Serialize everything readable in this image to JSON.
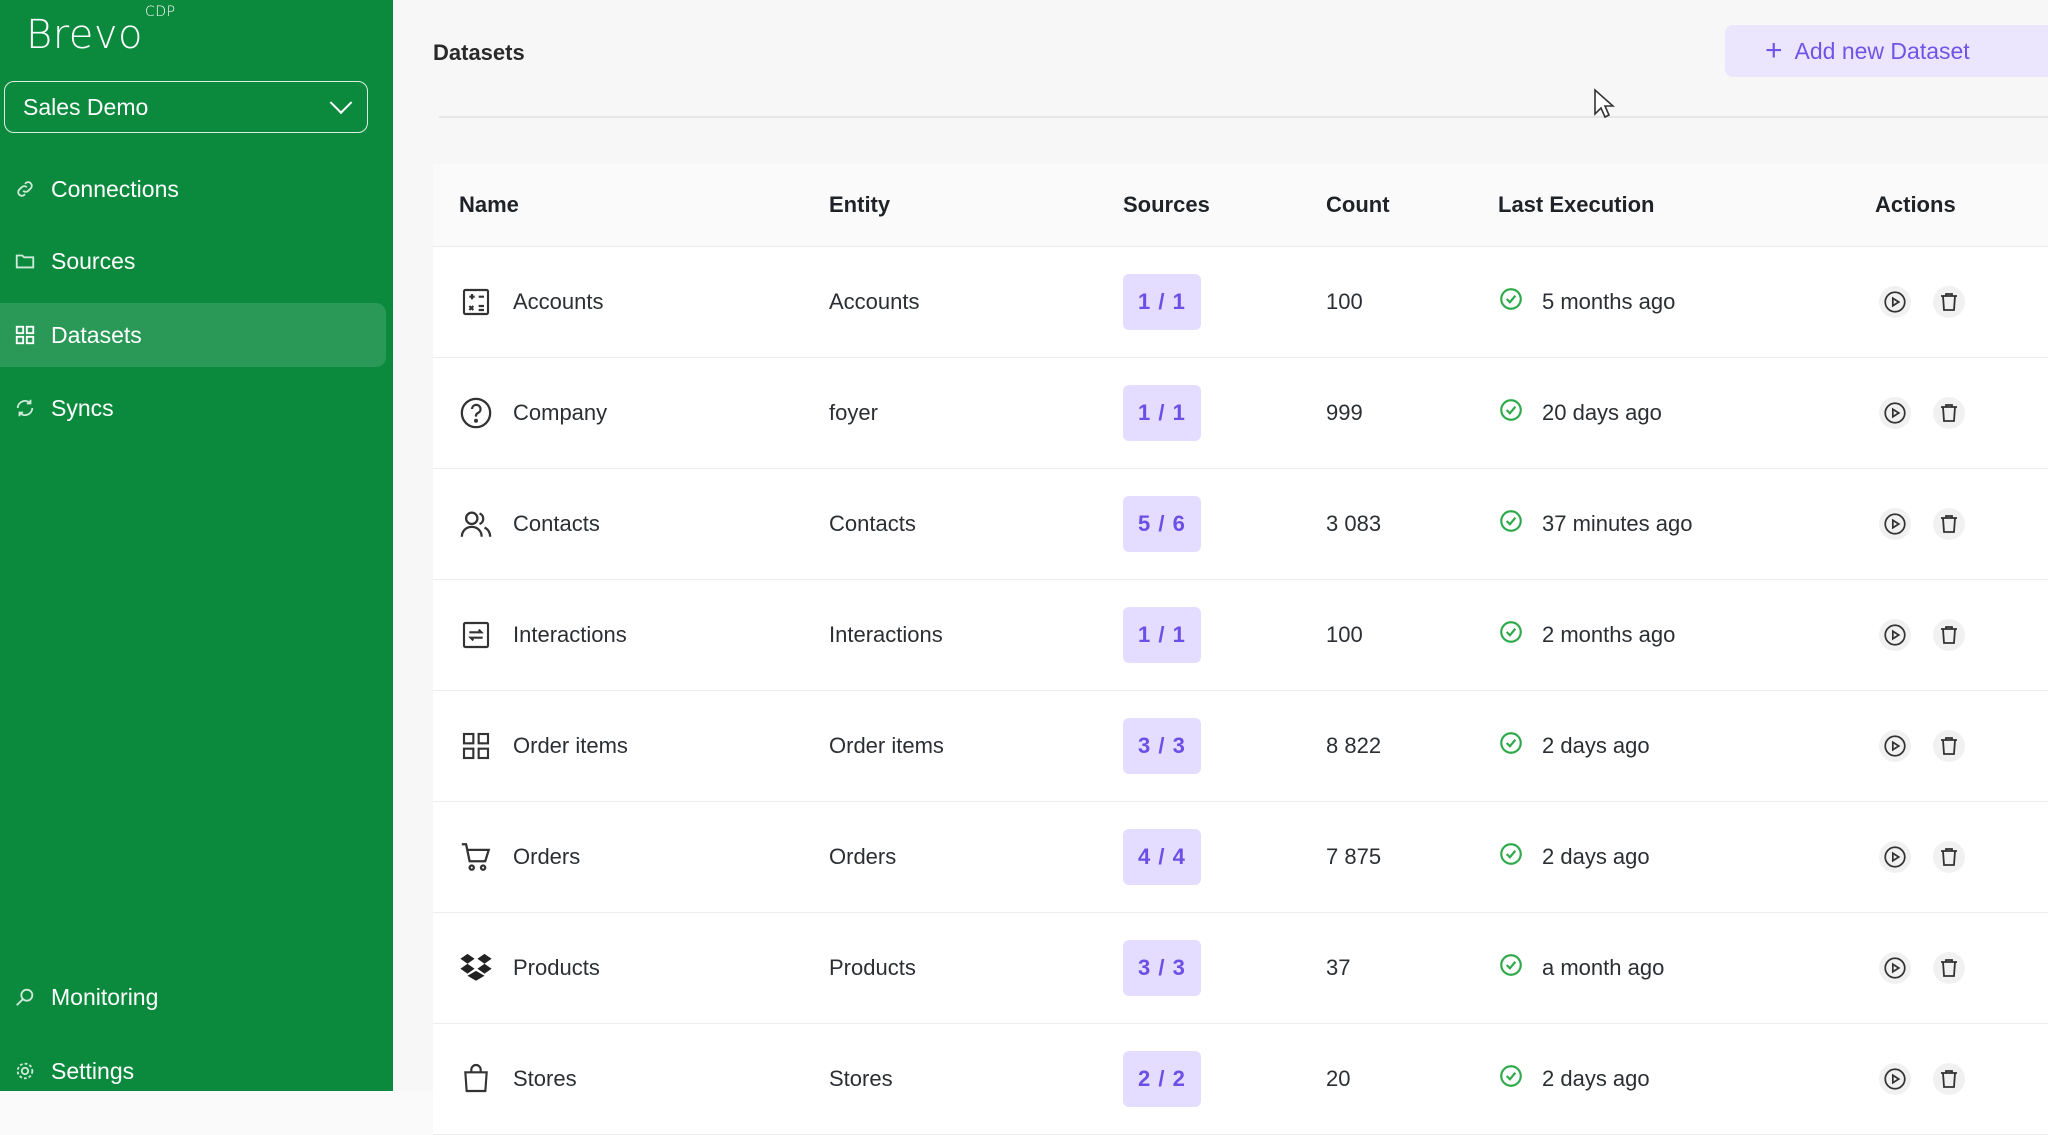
{
  "app": {
    "logo_text": "Brevo",
    "logo_sup": "CDP"
  },
  "sidebar": {
    "workspace": "Sales Demo",
    "items": [
      {
        "label": "Connections",
        "icon": "link-icon"
      },
      {
        "label": "Sources",
        "icon": "folder-icon"
      },
      {
        "label": "Datasets",
        "icon": "grid-icon",
        "active": true
      },
      {
        "label": "Syncs",
        "icon": "sync-icon"
      }
    ],
    "bottom_items": [
      {
        "label": "Monitoring",
        "icon": "monitor-icon"
      },
      {
        "label": "Settings",
        "icon": "gear-icon"
      }
    ]
  },
  "header": {
    "title": "Datasets",
    "add_button": "Add new Dataset"
  },
  "table": {
    "columns": [
      "Name",
      "Entity",
      "Sources",
      "Count",
      "Last Execution",
      "Actions"
    ],
    "rows": [
      {
        "name": "Accounts",
        "icon": "calculator-icon",
        "entity": "Accounts",
        "sources": "1 / 1",
        "count": "100",
        "last": "5 months ago"
      },
      {
        "name": "Company",
        "icon": "question-icon",
        "entity": "foyer",
        "sources": "1 / 1",
        "count": "999",
        "last": "20 days ago"
      },
      {
        "name": "Contacts",
        "icon": "users-icon",
        "entity": "Contacts",
        "sources": "5 / 6",
        "count": "3 083",
        "last": "37 minutes ago"
      },
      {
        "name": "Interactions",
        "icon": "interaction-icon",
        "entity": "Interactions",
        "sources": "1 / 1",
        "count": "100",
        "last": "2 months ago"
      },
      {
        "name": "Order items",
        "icon": "grid-icon",
        "entity": "Order items",
        "sources": "3 / 3",
        "count": "8 822",
        "last": "2 days ago"
      },
      {
        "name": "Orders",
        "icon": "cart-icon",
        "entity": "Orders",
        "sources": "4 / 4",
        "count": "7 875",
        "last": "2 days ago"
      },
      {
        "name": "Products",
        "icon": "dropbox-icon",
        "entity": "Products",
        "sources": "3 / 3",
        "count": "37",
        "last": "a month ago"
      },
      {
        "name": "Stores",
        "icon": "bag-icon",
        "entity": "Stores",
        "sources": "2 / 2",
        "count": "20",
        "last": "2 days ago"
      }
    ]
  },
  "colors": {
    "sidebar": "#0b8a3e",
    "accent": "#6e55e8",
    "badge_bg": "#e5ddff",
    "success": "#2faa4a"
  }
}
